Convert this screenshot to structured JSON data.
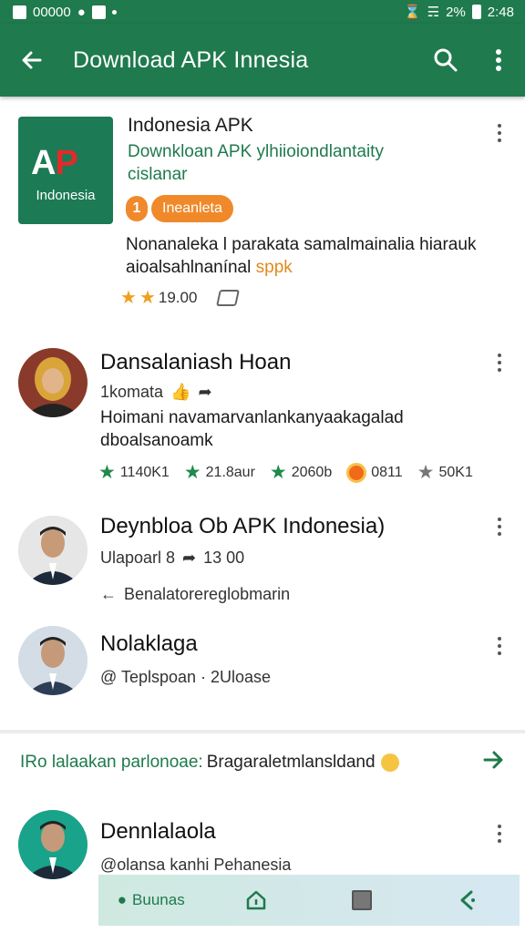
{
  "status_bar": {
    "left_text": "00000",
    "time": "2:48",
    "battery": "2%"
  },
  "app_bar": {
    "title": "Download APK Innesia"
  },
  "item1": {
    "logo_text": "AP",
    "logo_sub": "Indonesia",
    "title": "Indonesia APK",
    "subtitle": "Downkloan APK ylhiioiondlantaity cislanar",
    "badge_num": "1",
    "badge_text": "Ineanleta",
    "desc": "Nonanaleka l parakata samalmainalia hiarauk aioalsahlnanínal",
    "desc_highlight": "sppk",
    "rating": "19.00"
  },
  "item2": {
    "title": "Dansalaniash Hoan",
    "meta": "1komata",
    "desc": "Hoimani navamarvanlankanyaakagalad dboalsanoamk",
    "stats": [
      "1140K1",
      "21.8aur",
      "2060b",
      "0811",
      "50K1"
    ]
  },
  "item3": {
    "title": "Deynbloa Ob APK Indonesia)",
    "meta_left": "Ulapoarl 8",
    "meta_right": "13 00",
    "link": "Benalatorereglobmarin"
  },
  "item4": {
    "title": "Nolaklaga",
    "meta": "@ Teplspoan · 2Uloase"
  },
  "promo": {
    "green_text": "IRo lalaakan parlonoae:",
    "dark_text": "Bragaraletmlansldand"
  },
  "item5": {
    "title": "Dennlalaola",
    "meta": "@olansa kanhi Pehanesia"
  },
  "bottom_bar": {
    "first_label": "Buunas"
  },
  "colors": {
    "primary": "#1f7a4d",
    "accent": "#f0892a",
    "star": "#f0a020"
  }
}
